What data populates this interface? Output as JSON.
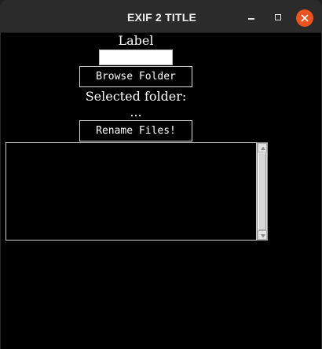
{
  "window": {
    "title": "EXIF 2 TITLE"
  },
  "form": {
    "label": "Label",
    "entry_value": "",
    "browse_button": "Browse Folder",
    "selected_folder_label": "Selected folder:",
    "selected_folder_value": "...",
    "rename_button": "Rename Files!"
  },
  "log": {
    "text": ""
  },
  "colors": {
    "background": "#000000",
    "titlebar": "#2b2b2b",
    "close_button": "#e95420"
  },
  "icons": {
    "minimize": "minimize-icon",
    "maximize": "maximize-icon",
    "close": "close-icon",
    "scroll_up": "arrow-up-icon",
    "scroll_down": "arrow-down-icon"
  }
}
